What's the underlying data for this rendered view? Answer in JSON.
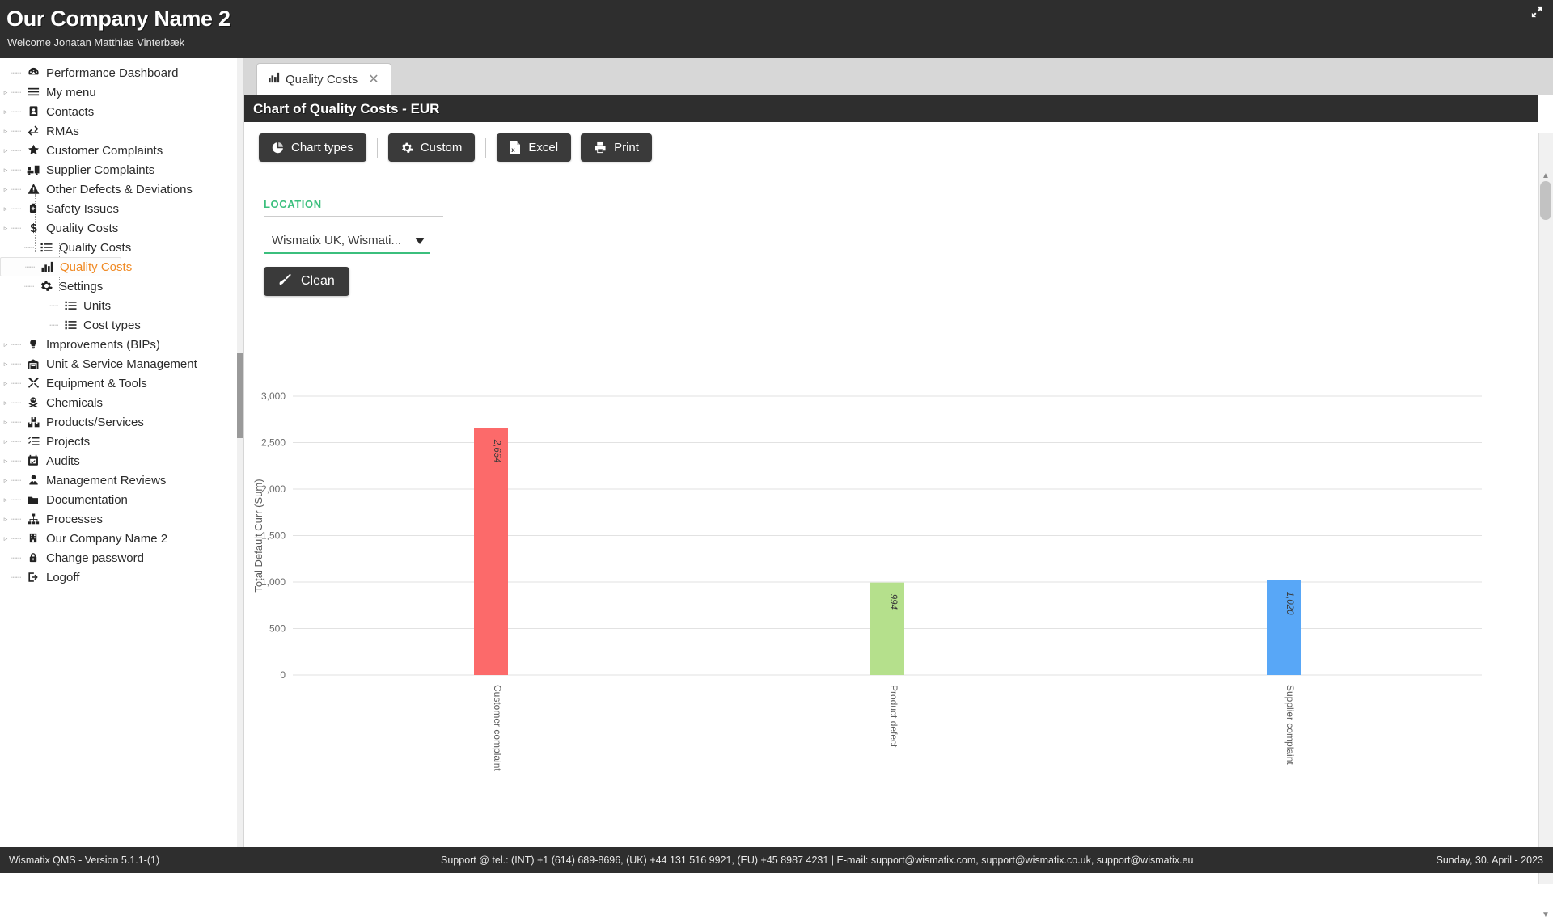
{
  "header": {
    "company_title": "Our Company Name 2",
    "welcome_text": "Welcome Jonatan Matthias Vinterbæk",
    "expand_icon": "expand-arrows-icon"
  },
  "sidebar": {
    "items": [
      {
        "label": "Performance Dashboard",
        "icon": "dashboard-icon",
        "level": 1,
        "expandable": false,
        "active": false
      },
      {
        "label": "My menu",
        "icon": "hamburger-menu-icon",
        "level": 1,
        "expandable": true,
        "active": false
      },
      {
        "label": "Contacts",
        "icon": "contact-card-icon",
        "level": 1,
        "expandable": true,
        "active": false
      },
      {
        "label": "RMAs",
        "icon": "exchange-arrows-icon",
        "level": 1,
        "expandable": true,
        "active": false
      },
      {
        "label": "Customer Complaints",
        "icon": "star-icon",
        "level": 1,
        "expandable": true,
        "active": false
      },
      {
        "label": "Supplier Complaints",
        "icon": "truck-loading-icon",
        "level": 1,
        "expandable": true,
        "active": false
      },
      {
        "label": "Other Defects & Deviations",
        "icon": "warning-triangle-icon",
        "level": 1,
        "expandable": true,
        "active": false
      },
      {
        "label": "Safety Issues",
        "icon": "safety-vest-icon",
        "level": 1,
        "expandable": true,
        "active": false
      },
      {
        "label": "Quality Costs",
        "icon": "dollar-sign-icon",
        "level": 1,
        "expandable": true,
        "active": false
      },
      {
        "label": "Quality Costs",
        "icon": "list-icon",
        "level": 2,
        "expandable": false,
        "active": false
      },
      {
        "label": "Quality Costs",
        "icon": "bar-chart-icon",
        "level": 2,
        "expandable": false,
        "active": true
      },
      {
        "label": "Settings",
        "icon": "gear-icon",
        "level": 2,
        "expandable": true,
        "active": false
      },
      {
        "label": "Units",
        "icon": "list-icon",
        "level": 3,
        "expandable": false,
        "active": false
      },
      {
        "label": "Cost types",
        "icon": "list-icon",
        "level": 3,
        "expandable": false,
        "active": false
      },
      {
        "label": "Improvements (BIPs)",
        "icon": "lightbulb-icon",
        "level": 1,
        "expandable": true,
        "active": false
      },
      {
        "label": "Unit & Service Management",
        "icon": "warehouse-icon",
        "level": 1,
        "expandable": true,
        "active": false
      },
      {
        "label": "Equipment & Tools",
        "icon": "tools-icon",
        "level": 1,
        "expandable": true,
        "active": false
      },
      {
        "label": "Chemicals",
        "icon": "hazard-skull-icon",
        "level": 1,
        "expandable": true,
        "active": false
      },
      {
        "label": "Products/Services",
        "icon": "boxes-icon",
        "level": 1,
        "expandable": true,
        "active": false
      },
      {
        "label": "Projects",
        "icon": "tasks-list-icon",
        "level": 1,
        "expandable": true,
        "active": false
      },
      {
        "label": "Audits",
        "icon": "calendar-check-icon",
        "level": 1,
        "expandable": true,
        "active": false
      },
      {
        "label": "Management Reviews",
        "icon": "user-tie-icon",
        "level": 1,
        "expandable": true,
        "active": false
      },
      {
        "label": "Documentation",
        "icon": "folder-icon",
        "level": 1,
        "expandable": true,
        "active": false
      },
      {
        "label": "Processes",
        "icon": "sitemap-icon",
        "level": 1,
        "expandable": true,
        "active": false
      },
      {
        "label": "Our Company Name 2",
        "icon": "building-icon",
        "level": 1,
        "expandable": true,
        "active": false
      },
      {
        "label": "Change password",
        "icon": "lock-icon",
        "level": 1,
        "expandable": false,
        "active": false
      },
      {
        "label": "Logoff",
        "icon": "logout-icon",
        "level": 1,
        "expandable": false,
        "active": false
      }
    ]
  },
  "tab": {
    "label": "Quality Costs",
    "icon": "bar-chart-icon",
    "close_icon": "close-icon"
  },
  "panel": {
    "title": "Chart of Quality Costs - EUR"
  },
  "toolbar": {
    "chart_types_label": "Chart types",
    "chart_types_icon": "pie-chart-icon",
    "custom_label": "Custom",
    "custom_icon": "gear-icon",
    "excel_label": "Excel",
    "excel_icon": "excel-file-icon",
    "print_label": "Print",
    "print_icon": "printer-icon"
  },
  "filters": {
    "location_label": "LOCATION",
    "location_value": "Wismatix UK, Wismati...",
    "location_caret_icon": "chevron-down-icon",
    "clean_label": "Clean",
    "clean_icon": "broom-icon"
  },
  "chart_data": {
    "type": "bar",
    "title": "Chart of Quality Costs - EUR",
    "xlabel": "",
    "ylabel": "Total Default Curr (Sum)",
    "ylim": [
      0,
      3000
    ],
    "yticks": [
      "0",
      "500",
      "1,000",
      "1,500",
      "2,000",
      "2,500",
      "3,000"
    ],
    "ytick_values": [
      0,
      500,
      1000,
      1500,
      2000,
      2500,
      3000
    ],
    "grid": true,
    "legend": "none",
    "categories": [
      "Customer complaint",
      "Product defect",
      "Supplier complaint"
    ],
    "values": [
      2654,
      994,
      1020
    ],
    "value_labels": [
      "2,654",
      "994",
      "1,020"
    ],
    "colors": [
      "#fc6a6a",
      "#b5e08c",
      "#58a7f7"
    ]
  },
  "footer": {
    "left": "Wismatix QMS - Version 5.1.1-(1)",
    "center": "Support @ tel.: (INT) +1 (614) 689-8696, (UK) +44 131 516 9921, (EU) +45 8987 4231 | E-mail: support@wismatix.com, support@wismatix.co.uk, support@wismatix.eu",
    "right": "Sunday, 30. April - 2023"
  }
}
